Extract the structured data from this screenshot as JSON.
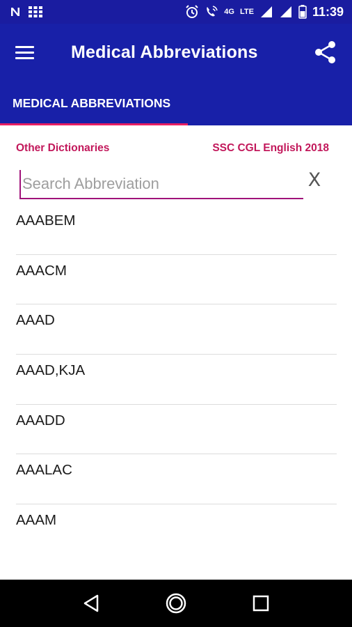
{
  "status_bar": {
    "time": "11:39",
    "network_label": "4G",
    "lte_label": "LTE",
    "icons": [
      "notification-n-icon",
      "grid-app-icon",
      "alarm-icon",
      "wifi-call-icon",
      "signal-icon",
      "battery-icon"
    ]
  },
  "app_bar": {
    "title": "Medical Abbreviations",
    "menu_icon": "hamburger-menu-icon",
    "share_icon": "share-icon"
  },
  "tabs": [
    {
      "label": "MEDICAL ABBREVIATIONS",
      "selected": true
    }
  ],
  "links": {
    "left": "Other Dictionaries",
    "right": "SSC CGL English 2018"
  },
  "search": {
    "placeholder": "Search Abbreviation",
    "value": "",
    "clear_label": "X"
  },
  "list": {
    "items": [
      "AAABEM",
      "AAACM",
      "AAAD",
      "AAAD,KJA",
      "AAADD",
      "AAALAC",
      "AAAM"
    ]
  },
  "nav_bar": {
    "icons": [
      "back-icon",
      "home-icon",
      "recents-icon"
    ]
  },
  "colors": {
    "primary": "#1820a8",
    "accent": "#e91e63",
    "link": "#c2185b"
  }
}
